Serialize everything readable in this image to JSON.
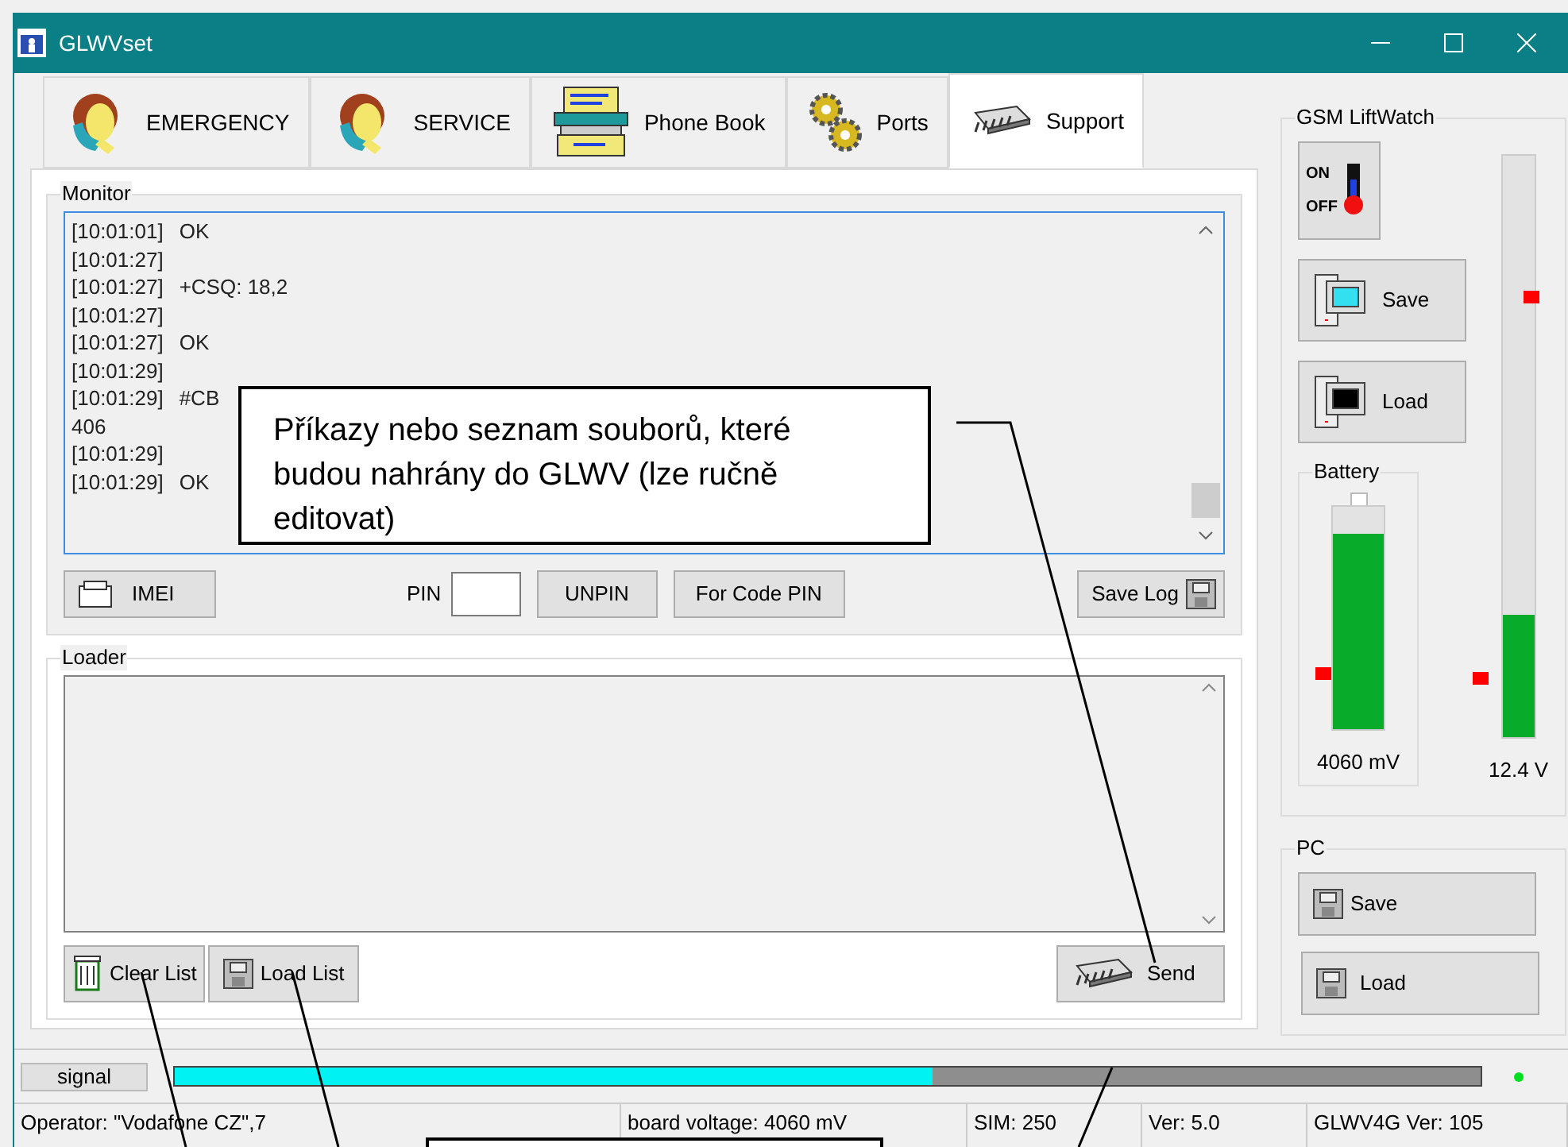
{
  "window": {
    "title": "GLWVset"
  },
  "tabs": [
    {
      "label": "EMERGENCY",
      "kind": "caller",
      "selected": false
    },
    {
      "label": "SERVICE",
      "kind": "caller",
      "selected": false
    },
    {
      "label": "Phone Book",
      "kind": "book",
      "selected": false
    },
    {
      "label": "Ports",
      "kind": "gears",
      "selected": false
    },
    {
      "label": "Support",
      "kind": "chip",
      "selected": true
    }
  ],
  "monitor": {
    "title": "Monitor",
    "lines": [
      {
        "time": "[10:01:01]",
        "text": "OK"
      },
      {
        "time": "[10:01:27]"
      },
      {
        "time": "[10:01:27]",
        "text": "+CSQ: 18,2"
      },
      {
        "time": "[10:01:27]"
      },
      {
        "time": "[10:01:27]",
        "text": "OK"
      },
      {
        "time": "[10:01:29]"
      },
      {
        "time": "[10:01:29]",
        "text": "#CB"
      },
      {
        "text": "406"
      },
      {
        "time": "[10:01:29]"
      },
      {
        "time": "[10:01:29]",
        "text": "OK"
      }
    ],
    "imei_button": "IMEI",
    "pin_label": "PIN",
    "unpin_button": "UNPIN",
    "code_pin_button": "For Code PIN",
    "save_log_button": "Save Log"
  },
  "loader": {
    "title": "Loader",
    "clear_button": "Clear List",
    "load_button": "Load List",
    "send_button": "Send"
  },
  "liftwatch": {
    "title": "GSM LiftWatch",
    "switch": {
      "on_label": "ON",
      "off_label": "OFF",
      "on": false
    },
    "save_button": "Save",
    "load_button": "Load",
    "battery": {
      "title": "Battery",
      "level": 0.88,
      "reading": "4060 mV"
    },
    "supply": {
      "level": 0.21,
      "reading": "12.4 V"
    }
  },
  "pc": {
    "title": "PC",
    "save_button": "Save",
    "load_button": "Load"
  },
  "signal": {
    "label": "signal",
    "level": 0.58,
    "led_on": true
  },
  "status_bar": [
    "Operator: \"Vodafone CZ\",7",
    "board voltage: 4060 mV",
    "SIM: 250",
    "Ver: 5.0",
    "GLWV4G Ver: 105"
  ],
  "callouts": [
    {
      "text": "Příkazy nebo seznam souborů, které budou nahrány do GLWV (lze ručně editovat)"
    }
  ]
}
